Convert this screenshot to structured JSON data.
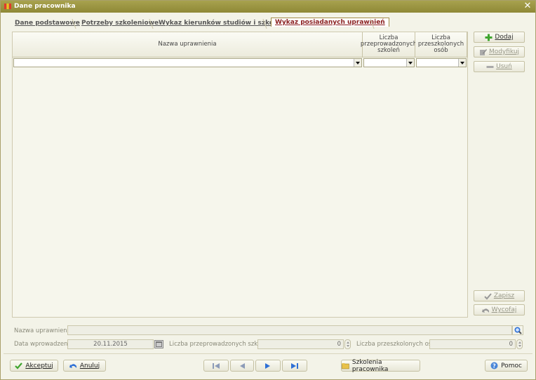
{
  "window": {
    "title": "Dane pracownika"
  },
  "tabs": [
    {
      "label": "Dane podstawowe"
    },
    {
      "label": "Potrzeby szkoleniowe"
    },
    {
      "label": "Wykaz kierunków studiów i szkoleń"
    },
    {
      "label": "Wykaz posiadanych uprawnień"
    }
  ],
  "grid": {
    "columns": [
      {
        "label": "Nazwa uprawnienia"
      },
      {
        "label": "Liczba przeprowadzonych szkoleń"
      },
      {
        "label": "Liczba przeszkolonych osób"
      }
    ]
  },
  "side_buttons": {
    "add": "Dodaj",
    "modify": "Modyfikuj",
    "delete": "Usuń",
    "save": "Zapisz",
    "revert": "Wycofaj"
  },
  "form": {
    "name_label": "Nazwa uprawnienia:",
    "name_value": "",
    "date_label": "Data wprowadzenia:",
    "date_value": "20.11.2015",
    "trainings_label": "Liczba przeprowadzonych szkoleń:",
    "trainings_value": "0",
    "trained_label": "Liczba przeszkolonych osób:",
    "trained_value": "0"
  },
  "footer": {
    "accept": "Akceptuj",
    "cancel": "Anuluj",
    "trainings": "Szkolenia pracownika",
    "help": "Pomoc"
  },
  "colors": {
    "titlebar": "#a09a45",
    "active_tab_text": "#8b2020",
    "add_icon": "#3fa52f",
    "accept_icon": "#3fa52f",
    "nav_active": "#2d6fd6"
  }
}
